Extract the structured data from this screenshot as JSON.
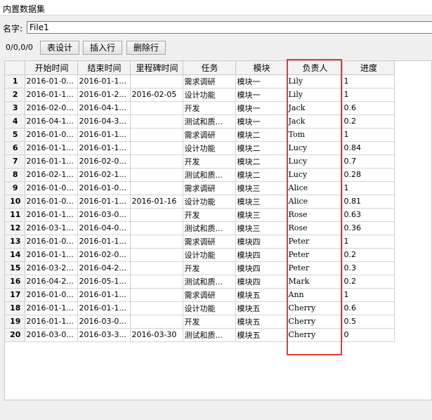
{
  "window": {
    "title": "内置数据集"
  },
  "name_field": {
    "label": "名字:",
    "value": "File1"
  },
  "toolbar": {
    "coords": "0/0,0/0",
    "design_label": "表设计",
    "insert_label": "插入行",
    "delete_label": "删除行"
  },
  "grid": {
    "columns": [
      "",
      "开始时间",
      "结束时间",
      "里程碑时间",
      "任务",
      "模块",
      "负责人",
      "进度"
    ],
    "rows": [
      [
        "1",
        "2016-01-0...",
        "2016-01-1...",
        "",
        "需求调研",
        "模块一",
        "Lily",
        "1"
      ],
      [
        "2",
        "2016-01-1...",
        "2016-01-2...",
        "2016-02-05",
        "设计功能",
        "模块一",
        "Lily",
        "1"
      ],
      [
        "3",
        "2016-02-0...",
        "2016-04-1...",
        "",
        "开发",
        "模块一",
        "Jack",
        "0.6"
      ],
      [
        "4",
        "2016-04-1...",
        "2016-04-3...",
        "",
        "测试和质...",
        "模块一",
        "Jack",
        "0.2"
      ],
      [
        "5",
        "2016-01-0...",
        "2016-01-1...",
        "",
        "需求调研",
        "模块二",
        "Tom",
        "1"
      ],
      [
        "6",
        "2016-01-1...",
        "2016-01-1...",
        "",
        "设计功能",
        "模块二",
        "Lucy",
        "0.84"
      ],
      [
        "7",
        "2016-01-1...",
        "2016-02-0...",
        "",
        "开发",
        "模块二",
        "Lucy",
        "0.7"
      ],
      [
        "8",
        "2016-02-1...",
        "2016-02-1...",
        "",
        "测试和质...",
        "模块二",
        "Lucy",
        "0.28"
      ],
      [
        "9",
        "2016-01-0...",
        "2016-01-0...",
        "",
        "需求调研",
        "模块三",
        "Alice",
        "1"
      ],
      [
        "10",
        "2016-01-0...",
        "2016-01-1...",
        "2016-01-16",
        "设计功能",
        "模块三",
        "Alice",
        "0.81"
      ],
      [
        "11",
        "2016-01-1...",
        "2016-03-0...",
        "",
        "开发",
        "模块三",
        "Rose",
        "0.63"
      ],
      [
        "12",
        "2016-03-1...",
        "2016-04-0...",
        "",
        "测试和质...",
        "模块三",
        "Rose",
        "0.36"
      ],
      [
        "13",
        "2016-01-0...",
        "2016-01-1...",
        "",
        "需求调研",
        "模块四",
        "Peter",
        "1"
      ],
      [
        "14",
        "2016-01-1...",
        "2016-02-0...",
        "",
        "设计功能",
        "模块四",
        "Peter",
        "0.2"
      ],
      [
        "15",
        "2016-03-2...",
        "2016-04-2...",
        "",
        "开发",
        "模块四",
        "Peter",
        "0.3"
      ],
      [
        "16",
        "2016-04-2...",
        "2016-05-1...",
        "",
        "测试和质...",
        "模块四",
        "Mark",
        "0.2"
      ],
      [
        "17",
        "2016-01-0...",
        "2016-01-1...",
        "",
        "需求调研",
        "模块五",
        "Ann",
        "1"
      ],
      [
        "18",
        "2016-01-1...",
        "2016-01-1...",
        "",
        "设计功能",
        "模块五",
        "Cherry",
        "0.6"
      ],
      [
        "19",
        "2016-01-1...",
        "2016-03-0...",
        "",
        "开发",
        "模块五",
        "Cherry",
        "0.5"
      ],
      [
        "20",
        "2016-03-0...",
        "2016-03-3...",
        "2016-03-30",
        "测试和质...",
        "模块五",
        "Cherry",
        "0"
      ]
    ]
  },
  "colors": {
    "highlight": "#e53935"
  }
}
